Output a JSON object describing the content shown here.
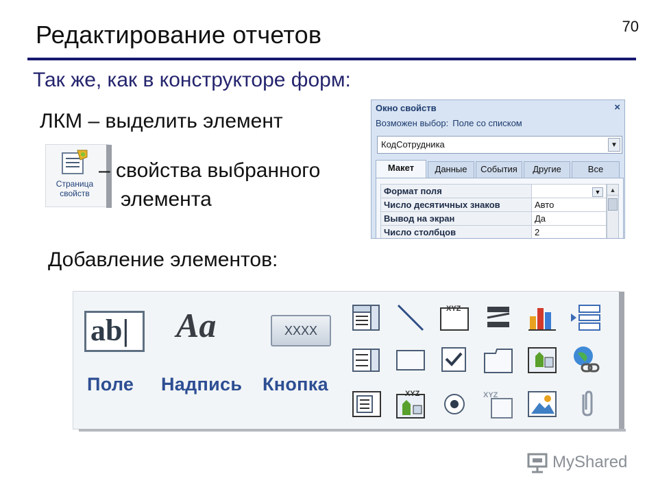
{
  "slide": {
    "number": "70",
    "title": "Редактирование отчетов",
    "subtitle": "Так же, как в конструкторе форм:",
    "lkm_text": "ЛКМ  – выделить  элемент",
    "props_text_line1": "– свойства выбранного",
    "props_text_line2": "элемента",
    "add_text": "Добавление элементов:"
  },
  "property_page_button": {
    "label_line1": "Страница",
    "label_line2": "свойств",
    "icon": "property-sheet-icon"
  },
  "property_sheet": {
    "title": "Окно свойств",
    "close_glyph": "×",
    "selection_label": "Возможен выбор:",
    "selection_type": "Поле со списком",
    "combo_value": "КодСотрудника",
    "tabs": [
      "Макет",
      "Данные",
      "События",
      "Другие",
      "Все"
    ],
    "active_tab": "Макет",
    "rows": [
      {
        "name": "Формат поля",
        "value": ""
      },
      {
        "name": "Число десятичных знаков",
        "value": "Авто"
      },
      {
        "name": "Вывод на экран",
        "value": "Да"
      },
      {
        "name": "Число столбцов",
        "value": "2"
      }
    ]
  },
  "toolbox": {
    "field_glyph": "ab|",
    "label_glyph": "Aa",
    "button_glyph": "XXXX",
    "field_label": "Поле",
    "label_label": "Надпись",
    "button_label": "Кнопка",
    "small_tools": [
      "combo-box-icon",
      "line-icon",
      "unbound-object-frame-icon",
      "page-break-icon",
      "chart-icon",
      "insert-page-icon",
      "list-box-icon",
      "rectangle-icon",
      "checkbox-icon",
      "tab-control-icon",
      "image-control-icon",
      "hyperlink-icon",
      "subform-icon",
      "bound-object-frame-icon",
      "option-button-icon",
      "option-group-icon",
      "image-icon",
      "attachment-icon"
    ]
  },
  "watermark": "MyShared",
  "colors": {
    "title_rule": "#16186e",
    "subtitle": "#25256e",
    "tool_label": "#2d4e93"
  }
}
